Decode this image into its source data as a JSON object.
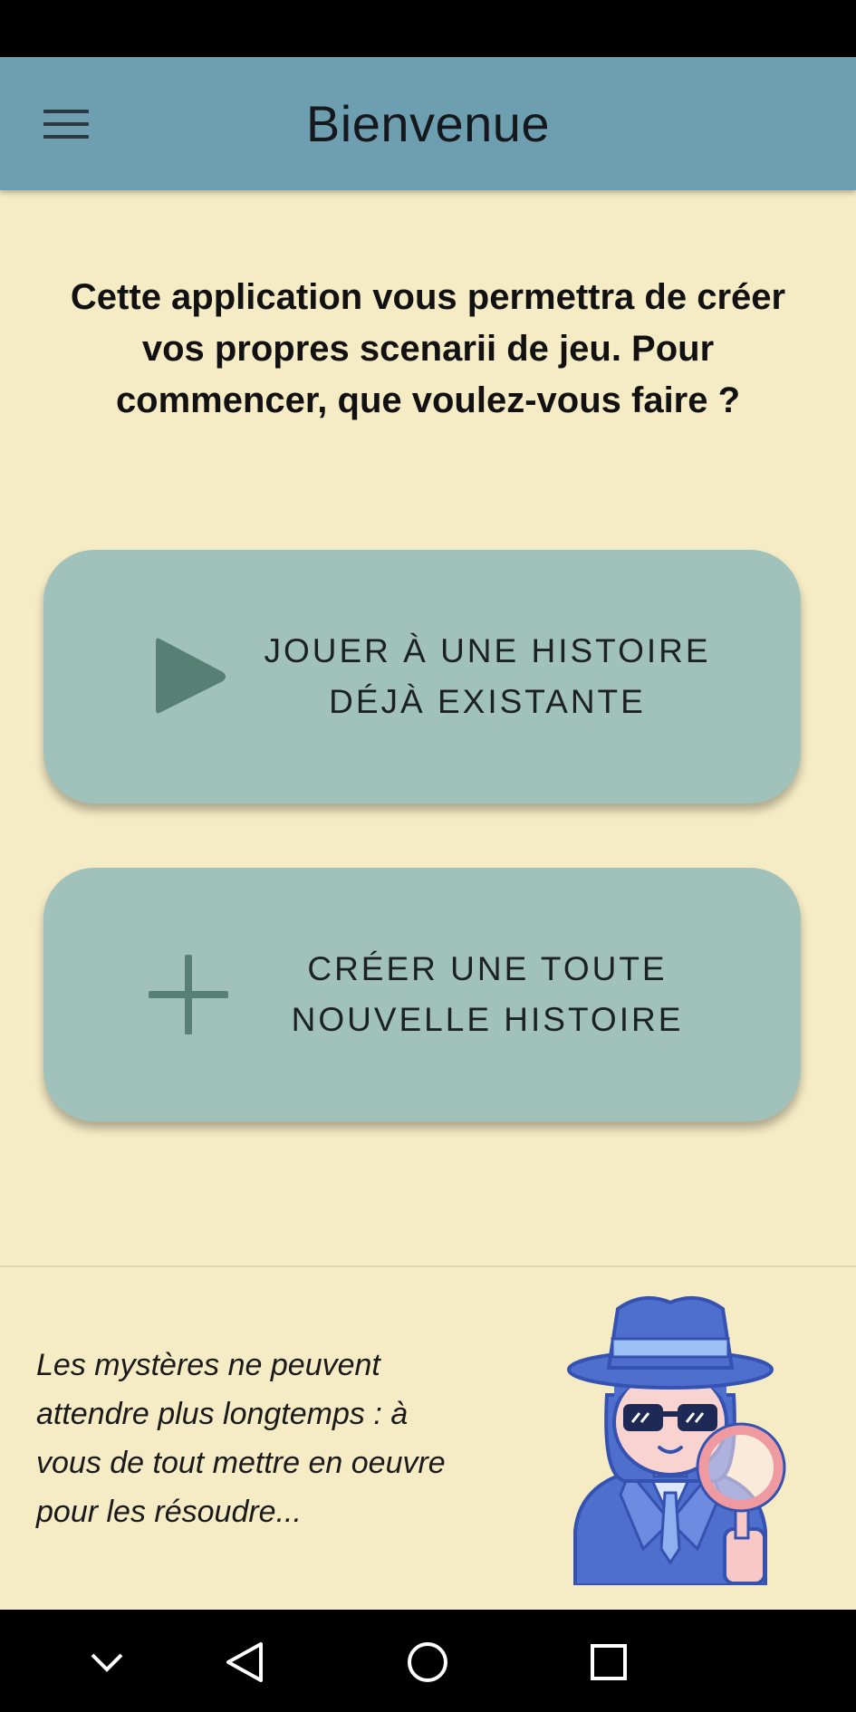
{
  "header": {
    "title": "Bienvenue",
    "menu_icon": "hamburger-menu-icon"
  },
  "intro": {
    "text": "Cette application vous permettra de créer vos propres scenarii de jeu. Pour commencer, que voulez-vous faire ?"
  },
  "actions": [
    {
      "icon": "play-icon",
      "label_line1": "JOUER À UNE HISTOIRE",
      "label_line2": "DÉJÀ EXISTANTE"
    },
    {
      "icon": "plus-icon",
      "label_line1": "CRÉER UNE TOUTE",
      "label_line2": "NOUVELLE HISTOIRE"
    }
  ],
  "footer": {
    "text": "Les mystères ne peuvent attendre plus longtemps : à vous de tout mettre en oeuvre pour les résoudre...",
    "illustration": "detective-illustration"
  },
  "navigation_bar": {
    "buttons": [
      "collapse-chevron-icon",
      "back-triangle-icon",
      "home-circle-icon",
      "recents-square-icon"
    ]
  },
  "colors": {
    "background": "#f5ebc5",
    "app_bar": "#6e9fb1",
    "card": "#a1c2bb",
    "card_icon": "#587f74",
    "detective_blue": "#4f6fce"
  }
}
